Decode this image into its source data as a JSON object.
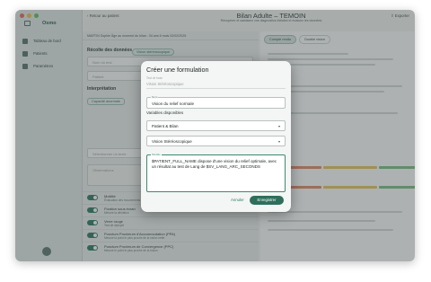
{
  "app": {
    "brand": "Osmo",
    "title": "Bilan Adulte – TEMOIN",
    "subtitle": "Récupérer et saisissez vos diagnostics initiales et évaluez les données",
    "back_label": "Retour au patient",
    "export_label": "Exporter"
  },
  "sidebar": {
    "items": [
      {
        "label": "Tableau de bord",
        "icon": "dashboard-icon"
      },
      {
        "label": "Patients",
        "icon": "users-icon"
      },
      {
        "label": "Paramètres",
        "icon": "gear-icon"
      }
    ]
  },
  "info_bar": {
    "text": "MARTIN Sophie   Âge au moment du bilan : 34 ans 6 mois   02/02/2025"
  },
  "left": {
    "section_title": "Récolte des données",
    "tag": "Vision stéréoscopique",
    "field1_placeholder": "Nom du test",
    "field2_placeholder": "Patient",
    "interp_title": "Interprétation",
    "interp_option": "Capacité anormale",
    "select_placeholder": "Sélectionner un texte",
    "obs_label": "Observations",
    "toggles": [
      {
        "title": "Motilité",
        "desc": "Évaluation des mouvements oculaires"
      },
      {
        "title": "Fixation sous écran",
        "desc": "Mesure la déviation"
      },
      {
        "title": "Verre rouge",
        "desc": "Test de diplopie"
      },
      {
        "title": "Punctum Proximum d'Accommodation (PPA)",
        "desc": "Mesure la point le plus proche de la vision nette"
      },
      {
        "title": "Punctum Proximum de Convergence (PPC)",
        "desc": "Mesure le point le plus proche de la fusion"
      }
    ]
  },
  "right": {
    "tabs": [
      "Compte rendu",
      "Double vision"
    ]
  },
  "modal": {
    "title": "Créer une formulation",
    "test_label": "Test de base",
    "test_value": "Vision Stéréoscopique",
    "name_label": "Nom",
    "name_value": "Vision du relief normale",
    "vars_title": "Variables disponibles",
    "var1": "Patient & Bilan",
    "var2": "Vision Stéréoscopique",
    "model_label": "Modèle",
    "model_value": "$PATIENT_FULL_NAME dispose d'une vision du relief optimale, avec un résultat au test de Lang de $SV_LANG_ARC_SECONDS",
    "cancel_label": "Annuler",
    "save_label": "Enregistrer"
  },
  "colors": {
    "accent": "#2e6f5c",
    "focus": "#3a8a70",
    "overlay": "rgba(60,70,68,0.42)"
  }
}
